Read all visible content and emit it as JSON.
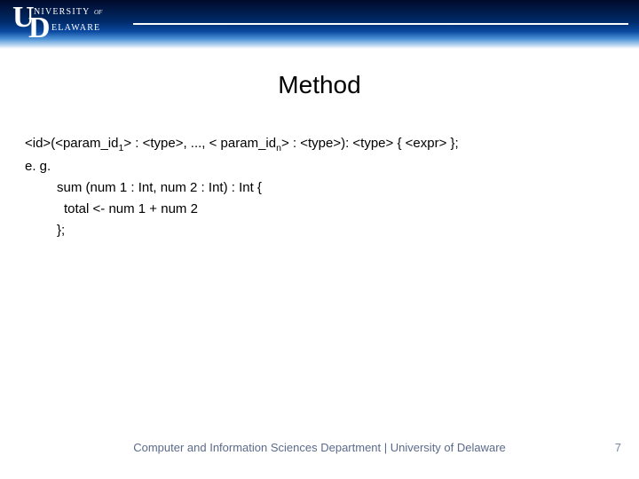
{
  "logo": {
    "top": "NIVERSITY",
    "small_of": "OF",
    "bottom": "ELAWARE"
  },
  "title": "Method",
  "lines": {
    "syntax_pre": "<id>(<param_id",
    "syntax_s1": "1",
    "syntax_mid1": "> : <type>, ..., < param_id",
    "syntax_sn": "n",
    "syntax_post": "> : <type>): <type> { <expr> };",
    "eg": "e. g.",
    "l1": "sum (num 1 : Int, num 2 : Int) : Int {",
    "l2": "total <- num 1 + num 2",
    "l3": "};"
  },
  "footer": "Computer and Information Sciences Department | University of Delaware",
  "page": "7"
}
